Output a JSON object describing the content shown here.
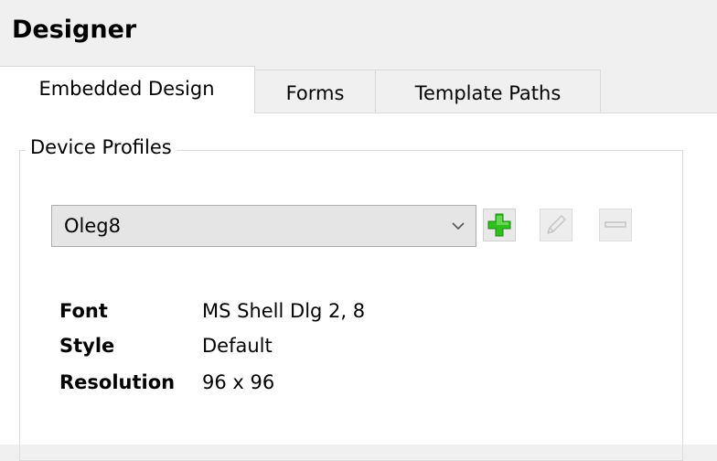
{
  "window": {
    "title": "Designer"
  },
  "tabs": [
    {
      "label": "Embedded Design",
      "active": true
    },
    {
      "label": "Forms",
      "active": false
    },
    {
      "label": "Template Paths",
      "active": false
    }
  ],
  "device_profiles": {
    "group_label": "Device Profiles",
    "selected_profile": "Oleg8",
    "buttons": {
      "add": {
        "icon": "plus-icon",
        "color": "#2fbf1f",
        "enabled": true
      },
      "edit": {
        "icon": "pencil-icon",
        "enabled": false
      },
      "remove": {
        "icon": "minus-icon",
        "enabled": false
      }
    },
    "properties": {
      "font_label": "Font",
      "font_value": "MS Shell Dlg 2, 8",
      "style_label": "Style",
      "style_value": "Default",
      "resolution_label": "Resolution",
      "resolution_value": "96 x 96"
    }
  }
}
